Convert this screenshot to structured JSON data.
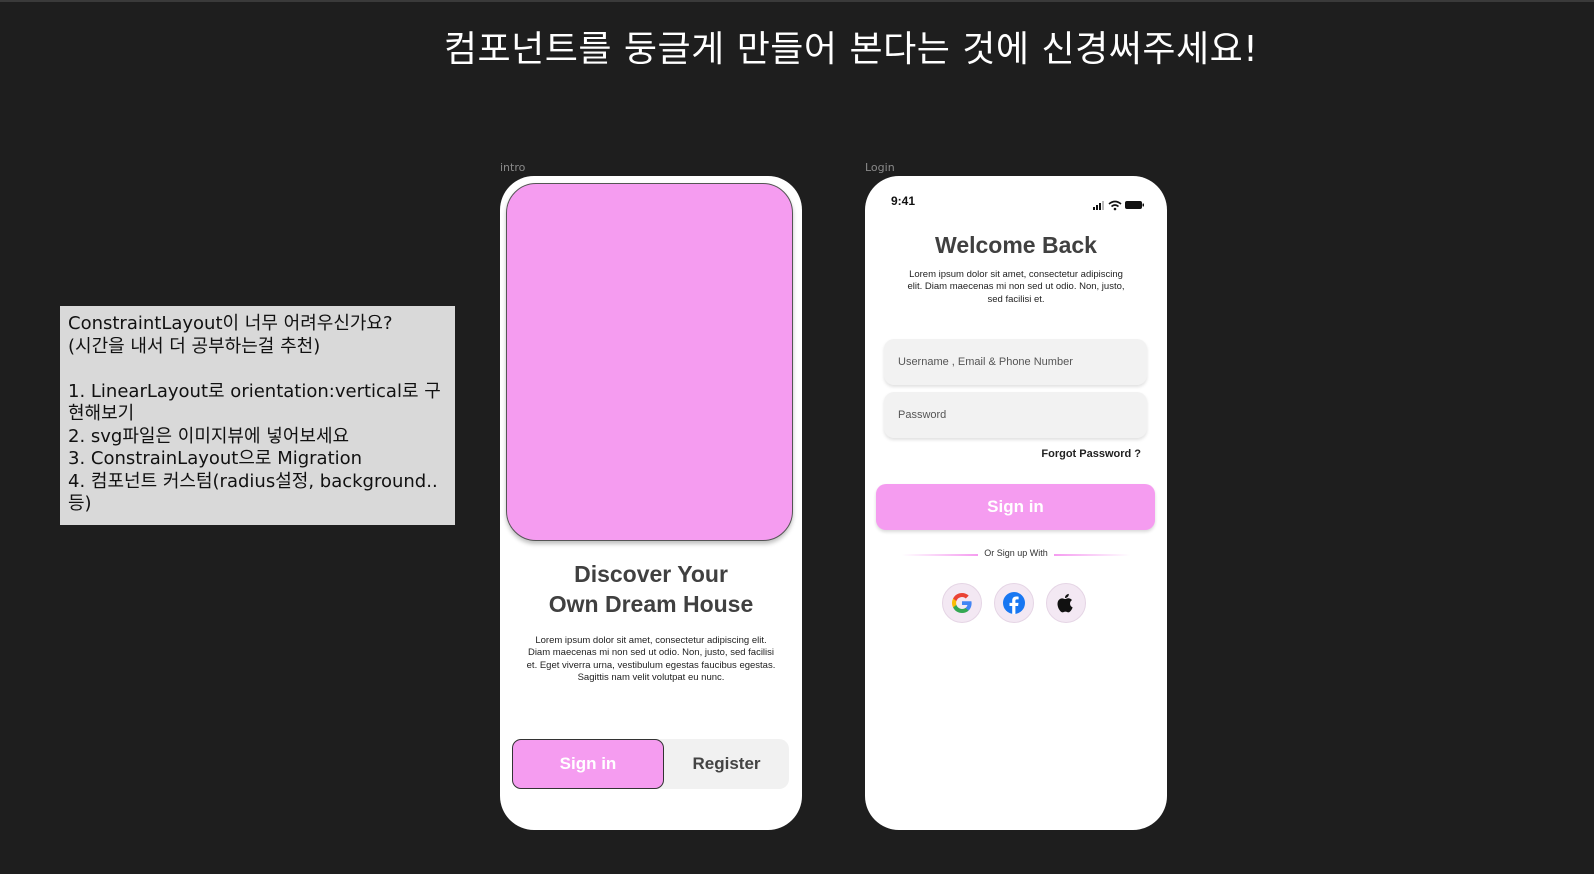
{
  "banner": {
    "text": "컴포넌트를 둥글게 만들어 본다는 것에 신경써주세요!"
  },
  "note": {
    "lines": [
      "ConstraintLayout이 너무 어려우신가요?",
      "(시간을 내서 더 공부하는걸 추천)",
      "",
      "1. LinearLayout로 orientation:vertical로 구현해보기",
      "2. svg파일은 이미지뷰에 넣어보세요",
      "3. ConstrainLayout으로 Migration",
      "4. 컴포넌트 커스텀(radius설정, background.. 등)"
    ]
  },
  "intro": {
    "frame_label": "intro",
    "title_line1": "Discover Your",
    "title_line2": "Own Dream House",
    "body": "Lorem ipsum dolor sit amet, consectetur adipiscing elit. Diam maecenas mi non sed ut odio. Non, justo, sed facilisi et. Eget viverra urna, vestibulum egestas faucibus egestas. Sagittis nam velit volutpat eu nunc.",
    "signin_label": "Sign in",
    "register_label": "Register"
  },
  "login": {
    "frame_label": "Login",
    "status_time": "9:41",
    "title": "Welcome Back",
    "body": "Lorem ipsum dolor sit amet, consectetur adipiscing elit. Diam maecenas mi non sed ut odio. Non, justo, sed facilisi et.",
    "username_placeholder": "Username , Email & Phone Number",
    "password_placeholder": "Password",
    "forgot_label": "Forgot Password ?",
    "signin_label": "Sign in",
    "divider_label": "Or Sign up With",
    "social_icons": [
      "google-icon",
      "facebook-icon",
      "apple-icon"
    ]
  },
  "colors": {
    "accent_pink": "#f59cf0",
    "background": "#1e1e1e",
    "note_background": "#d9d9d9"
  }
}
